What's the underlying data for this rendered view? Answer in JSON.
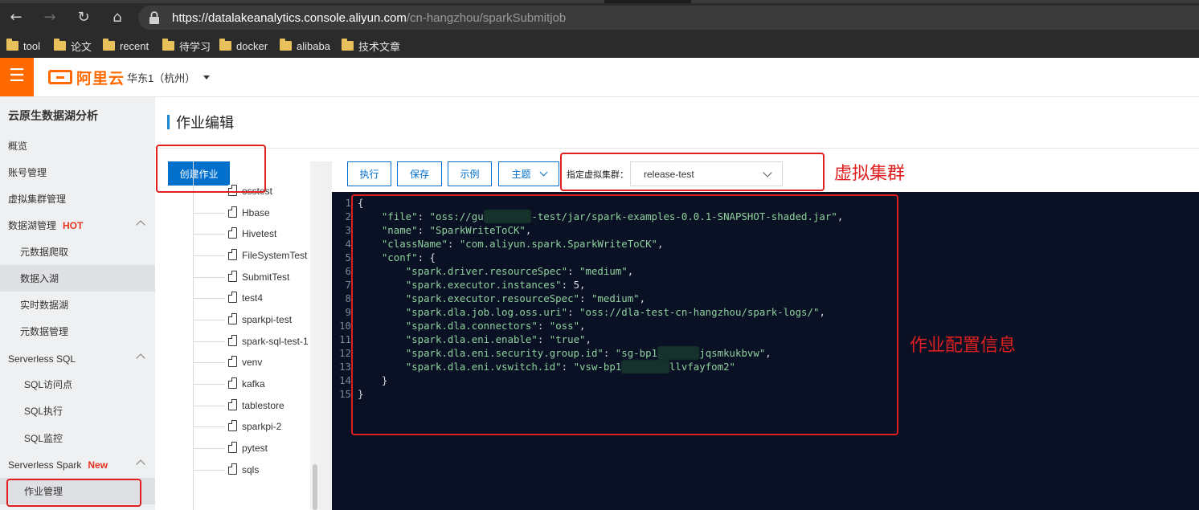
{
  "browser": {
    "url_host": "https://datalakeanalytics.console.aliyun.com",
    "url_path": "/cn-hangzhou/sparkSubmitjob",
    "bookmarks": [
      "tool",
      "论文",
      "recent",
      "待学习",
      "docker",
      "alibaba",
      "技术文章"
    ]
  },
  "header": {
    "logo_text": "阿里云",
    "region": "华东1（杭州）"
  },
  "sidebar": {
    "title": "云原生数据湖分析",
    "items": [
      {
        "label": "概览"
      },
      {
        "label": "账号管理"
      },
      {
        "label": "虚拟集群管理"
      },
      {
        "label": "数据湖管理",
        "badge": "HOT"
      },
      {
        "label": "元数据爬取"
      },
      {
        "label": "数据入湖"
      },
      {
        "label": "实时数据湖"
      },
      {
        "label": "元数据管理"
      },
      {
        "label": "Serverless SQL"
      },
      {
        "label": "SQL访问点"
      },
      {
        "label": "SQL执行"
      },
      {
        "label": "SQL监控"
      },
      {
        "label": "Serverless Spark",
        "badge": "New"
      },
      {
        "label": "作业管理"
      }
    ]
  },
  "main": {
    "page_title": "作业编辑",
    "create_button": "创建作业",
    "toolbar": {
      "run": "执行",
      "save": "保存",
      "example": "示例",
      "theme": "主题",
      "cluster_label": "指定虚拟集群：",
      "cluster_value": "release-test"
    },
    "job_list": [
      "osstest",
      "Hbase",
      "Hivetest",
      "FileSystemTest",
      "SubmitTest",
      "test4",
      "sparkpi-test",
      "spark-sql-test-1",
      "venv",
      "kafka",
      "tablestore",
      "sparkpi-2",
      "pytest",
      "sqls"
    ]
  },
  "editor": {
    "line_numbers": [
      "1",
      "2",
      "3",
      "4",
      "5",
      "6",
      "7",
      "8",
      "9",
      "10",
      "11",
      "12",
      "13",
      "14",
      "15"
    ],
    "code": {
      "l1": "{",
      "l2_key": "\"file\"",
      "l2_val_a": "\"oss://gu",
      "l2_val_b": "-test/jar/spark-examples-0.0.1-SNAPSHOT-shaded.jar\"",
      "l3_key": "\"name\"",
      "l3_val": "\"SparkWriteToCK\"",
      "l4_key": "\"className\"",
      "l4_val": "\"com.aliyun.spark.SparkWriteToCK\"",
      "l5_key": "\"conf\"",
      "l6_key": "\"spark.driver.resourceSpec\"",
      "l6_val": "\"medium\"",
      "l7_key": "\"spark.executor.instances\"",
      "l7_val": "5",
      "l8_key": "\"spark.executor.resourceSpec\"",
      "l8_val": "\"medium\"",
      "l9_key": "\"spark.dla.job.log.oss.uri\"",
      "l9_val": "\"oss://dla-test-cn-hangzhou/spark-logs/\"",
      "l10_key": "\"spark.dla.connectors\"",
      "l10_val": "\"oss\"",
      "l11_key": "\"spark.dla.eni.enable\"",
      "l11_val": "\"true\"",
      "l12_key": "\"spark.dla.eni.security.group.id\"",
      "l12_val_a": "\"sg-bp1",
      "l12_val_b": "jqsmkukbvw\"",
      "l13_key": "\"spark.dla.eni.vswitch.id\"",
      "l13_val_a": "\"vsw-bp1",
      "l13_val_b": "llvfayfom2\"",
      "l14": "}",
      "l15": "}"
    }
  },
  "annotations": {
    "cluster": "虚拟集群",
    "config": "作业配置信息"
  }
}
